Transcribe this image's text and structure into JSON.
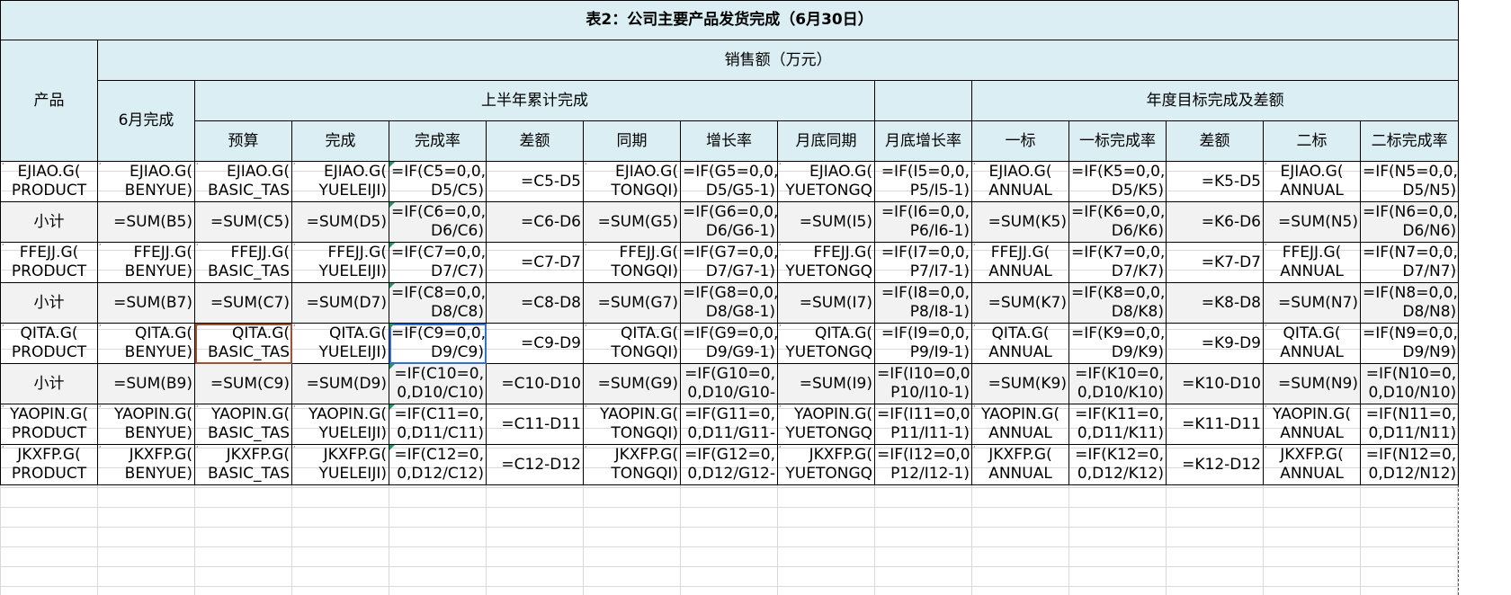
{
  "title": "表2：公司主要产品发货完成（6月30日）",
  "headers": {
    "product": "产品",
    "sales": "销售额（万元）",
    "june": "6月完成",
    "half_year": "上半年累计完成",
    "annual": "年度目标完成及差额",
    "cols": [
      "预算",
      "完成",
      "完成率",
      "差额",
      "同期",
      "增长率",
      "月底同期",
      "月底增长率",
      "一标",
      "一标完成率",
      "差额",
      "二标",
      "二标完成率"
    ]
  },
  "rows": [
    {
      "type": "product",
      "cells": [
        "EJIAO.G(\nPRODUCT",
        "EJIAO.G(\nBENYUE)",
        "EJIAO.G(\nBASIC_TAS",
        "EJIAO.G(\nYUELEIJI)",
        "=IF(C5=0,0,\nD5/C5)",
        "=C5-D5",
        "EJIAO.G(\nTONGQI)",
        "=IF(G5=0,0,\nD5/G5-1)",
        "EJIAO.G(\nYUETONGQ",
        "=IF(I5=0,0,\nP5/I5-1)",
        "EJIAO.G(\nANNUAL",
        "=IF(K5=0,0,\nD5/K5)",
        "=K5-D5",
        "EJIAO.G(\nANNUAL",
        "=IF(N5=0,0,\nD5/N5)"
      ]
    },
    {
      "type": "sub",
      "cells": [
        "小计",
        "=SUM(B5)",
        "=SUM(C5)",
        "=SUM(D5)",
        "=IF(C6=0,0,\nD6/C6)",
        "=C6-D6",
        "=SUM(G5)",
        "=IF(G6=0,0,\nD6/G6-1)",
        "=SUM(I5)",
        "=IF(I6=0,0,\nP6/I6-1)",
        "=SUM(K5)",
        "=IF(K6=0,0,\nD6/K6)",
        "=K6-D6",
        "=SUM(N5)",
        "=IF(N6=0,0,\nD6/N6)"
      ]
    },
    {
      "type": "product",
      "cells": [
        "FFEJJ.G(\nPRODUCT",
        "FFEJJ.G(\nBENYUE)",
        "FFEJJ.G(\nBASIC_TAS",
        "FFEJJ.G(\nYUELEIJI)",
        "=IF(C7=0,0,\nD7/C7)",
        "=C7-D7",
        "FFEJJ.G(\nTONGQI)",
        "=IF(G7=0,0,\nD7/G7-1)",
        "FFEJJ.G(\nYUETONGQ",
        "=IF(I7=0,0,\nP7/I7-1)",
        "FFEJJ.G(\nANNUAL",
        "=IF(K7=0,0,\nD7/K7)",
        "=K7-D7",
        "FFEJJ.G(\nANNUAL",
        "=IF(N7=0,0,\nD7/N7)"
      ]
    },
    {
      "type": "sub",
      "cells": [
        "小计",
        "=SUM(B7)",
        "=SUM(C7)",
        "=SUM(D7)",
        "=IF(C8=0,0,\nD8/C8)",
        "=C8-D8",
        "=SUM(G7)",
        "=IF(G8=0,0,\nD8/G8-1)",
        "=SUM(I7)",
        "=IF(I8=0,0,\nP8/I8-1)",
        "=SUM(K7)",
        "=IF(K8=0,0,\nD8/K8)",
        "=K8-D8",
        "=SUM(N7)",
        "=IF(N8=0,0,\nD8/N8)"
      ]
    },
    {
      "type": "product",
      "cells": [
        "QITA.G(\nPRODUCT",
        "QITA.G(\nBENYUE)",
        "QITA.G(\nBASIC_TAS",
        "QITA.G(\nYUELEIJI)",
        "=IF(C9=0,0,\nD9/C9)",
        "=C9-D9",
        "QITA.G(\nTONGQI)",
        "=IF(G9=0,0,\nD9/G9-1)",
        "QITA.G(\nYUETONGQ",
        "=IF(I9=0,0,\nP9/I9-1)",
        "QITA.G(\nANNUAL",
        "=IF(K9=0,0,\nD9/K9)",
        "=K9-D9",
        "QITA.G(\nANNUAL",
        "=IF(N9=0,0,\nD9/N9)"
      ]
    },
    {
      "type": "sub",
      "cells": [
        "小计",
        "=SUM(B9)",
        "=SUM(C9)",
        "=SUM(D9)",
        "=IF(C10=0,\n0,D10/C10)",
        "=C10-D10",
        "=SUM(G9)",
        "=IF(G10=0,\n0,D10/G10-",
        "=SUM(I9)",
        "=IF(I10=0,0,\nP10/I10-1)",
        "=SUM(K9)",
        "=IF(K10=0,\n0,D10/K10)",
        "=K10-D10",
        "=SUM(N9)",
        "=IF(N10=0,\n0,D10/N10)"
      ]
    },
    {
      "type": "product",
      "cells": [
        "YAOPIN.G(\nPRODUCT",
        "YAOPIN.G(\nBENYUE)",
        "YAOPIN.G(\nBASIC_TAS",
        "YAOPIN.G(\nYUELEIJI)",
        "=IF(C11=0,\n0,D11/C11)",
        "=C11-D11",
        "YAOPIN.G(\nTONGQI)",
        "=IF(G11=0,\n0,D11/G11-",
        "YAOPIN.G(\nYUETONGQ",
        "=IF(I11=0,0,\nP11/I11-1)",
        "YAOPIN.G(\nANNUAL",
        "=IF(K11=0,\n0,D11/K11)",
        "=K11-D11",
        "YAOPIN.G(\nANNUAL",
        "=IF(N11=0,\n0,D11/N11)"
      ]
    },
    {
      "type": "product",
      "cells": [
        "JKXFP.G(\nPRODUCT",
        "JKXFP.G(\nBENYUE)",
        "JKXFP.G(\nBASIC_TAS",
        "JKXFP.G(\nYUELEIJI)",
        "=IF(C12=0,\n0,D12/C12)",
        "=C12-D12",
        "JKXFP.G(\nTONGQI)",
        "=IF(G12=0,\n0,D12/G12-",
        "JKXFP.G(\nYUETONGQ",
        "=IF(I12=0,0,\nP12/I12-1)",
        "JKXFP.G(\nANNUAL",
        "=IF(K12=0,\n0,D12/K12)",
        "=K12-D12",
        "JKXFP.G(\nANNUAL",
        "=IF(N12=0,\n0,D12/N12)"
      ]
    }
  ]
}
